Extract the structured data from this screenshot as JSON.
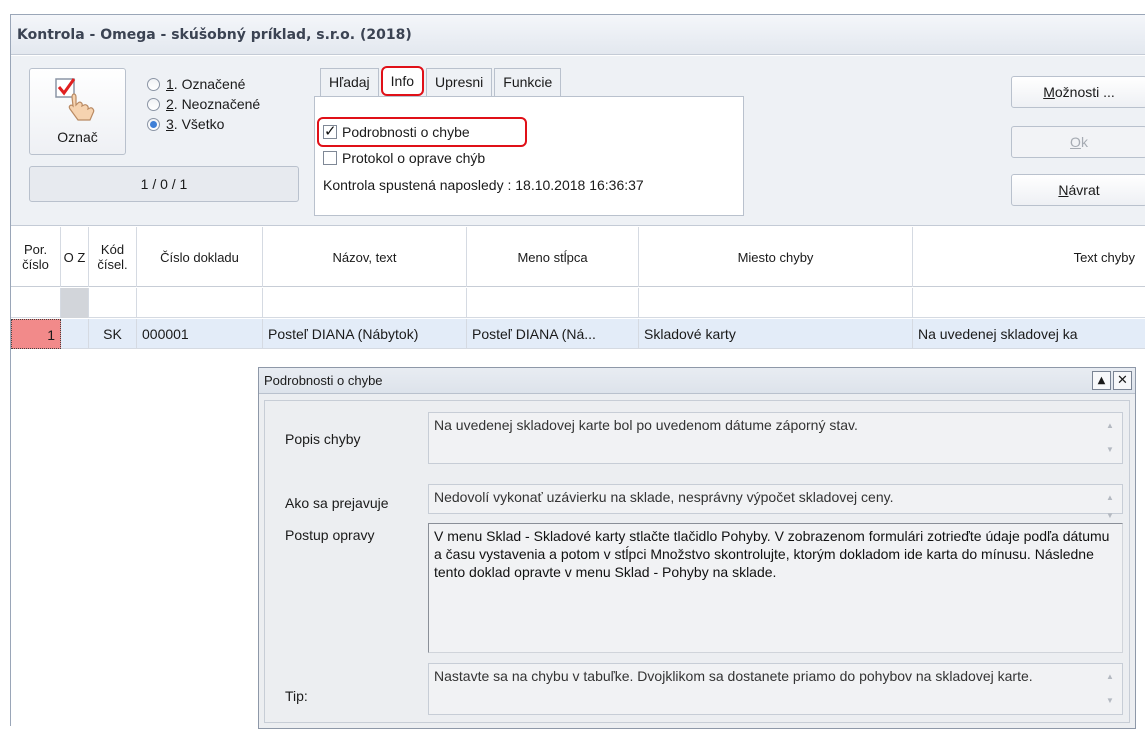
{
  "window": {
    "title": "Kontrola - Omega - skúšobný príklad, s.r.o. (2018)"
  },
  "toolbar": {
    "mark_button_label": "Označ",
    "radios": [
      {
        "key": "1",
        "rest": ". Označené",
        "selected": false
      },
      {
        "key": "2",
        "rest": ". Neoznačené",
        "selected": false
      },
      {
        "key": "3",
        "rest": ". Všetko",
        "selected": true
      }
    ],
    "counter": "1 / 0 / 1"
  },
  "tabs": [
    {
      "label": "Hľadaj",
      "active": false
    },
    {
      "label": "Info",
      "active": true
    },
    {
      "label": "Upresni",
      "active": false
    },
    {
      "label": "Funkcie",
      "active": false
    }
  ],
  "info_panel": {
    "details_checkbox": {
      "label": "Podrobnosti o chybe",
      "checked": true
    },
    "protocol_checkbox": {
      "label": "Protokol o oprave chýb",
      "checked": false
    },
    "last_run": "Kontrola spustená naposledy : 18.10.2018 16:36:37"
  },
  "side_buttons": {
    "options_mn": "M",
    "options_rest": "ožnosti ...",
    "ok_mn": "O",
    "ok_rest": "k",
    "back_mn": "N",
    "back_rest": "ávrat"
  },
  "grid": {
    "headers": {
      "por": "Por. číslo",
      "oz": "O Z",
      "kod": "Kód čísel.",
      "doklad": "Číslo dokladu",
      "nazov": "Názov, text",
      "meno": "Meno stĺpca",
      "miesto": "Miesto chyby",
      "text": "Text chyby"
    },
    "row": {
      "por": "1",
      "oz": "",
      "kod": "SK",
      "doklad": "000001",
      "nazov": "Posteľ DIANA (Nábytok)",
      "meno": "Posteľ DIANA (Ná...",
      "miesto": "Skladové karty",
      "text": "Na uvedenej skladovej ka"
    }
  },
  "dialog": {
    "title": "Podrobnosti o chybe",
    "popis_label": "Popis chyby",
    "popis_value": "Na uvedenej skladovej karte bol po uvedenom dátume záporný stav.",
    "ako_label": "Ako sa prejavuje",
    "ako_value": "Nedovolí vykonať uzávierku na sklade, nesprávny výpočet skladovej ceny.",
    "postup_label": "Postup opravy",
    "postup_value": "V menu Sklad - Skladové karty stlačte tlačidlo Pohyby. V zobrazenom formulári zotrieďte údaje podľa dátumu a času vystavenia a potom v stĺpci Množstvo skontrolujte, ktorým dokladom ide karta do mínusu. Následne tento doklad opravte v menu Sklad - Pohyby na sklade.",
    "tip_label": "Tip:",
    "tip_value": "Nastavte sa na chybu v tabuľke. Dvojklikom sa dostanete priamo do pohybov na skladovej karte."
  },
  "colors": {
    "accent_red": "#e01018",
    "selected_row": "#e3ecf8",
    "error_cell": "#f28a8a",
    "radio_selected": "#3f7fd6"
  }
}
